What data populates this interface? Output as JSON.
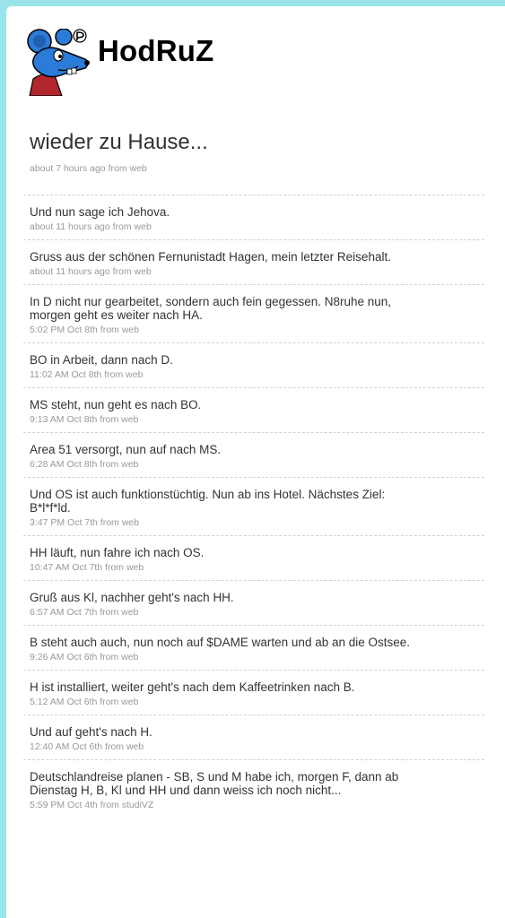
{
  "profile": {
    "username": "HodRuZ"
  },
  "latest": {
    "text": "wieder zu Hause...",
    "meta": "about 7 hours ago from web"
  },
  "timeline": [
    {
      "text": "Und nun sage ich Jehova.",
      "meta": "about 11 hours ago from web"
    },
    {
      "text": "Gruss aus der schönen Fernunistadt Hagen, mein letzter Reisehalt.",
      "meta": "about 11 hours ago from web"
    },
    {
      "text": "In D nicht nur gearbeitet, sondern auch fein gegessen. N8ruhe nun, morgen geht es weiter nach HA.",
      "meta": "5:02 PM Oct 8th from web"
    },
    {
      "text": "BO in Arbeit, dann nach D.",
      "meta": "11:02 AM Oct 8th from web"
    },
    {
      "text": "MS steht, nun geht es nach BO.",
      "meta": "9:13 AM Oct 8th from web"
    },
    {
      "text": "Area 51 versorgt, nun auf nach MS.",
      "meta": "6:28 AM Oct 8th from web"
    },
    {
      "text": "Und OS ist auch funktionstüchtig. Nun ab ins Hotel. Nächstes Ziel: B*l*f*ld.",
      "meta": "3:47 PM Oct 7th from web"
    },
    {
      "text": "HH läuft, nun fahre ich nach OS.",
      "meta": "10:47 AM Oct 7th from web"
    },
    {
      "text": "Gruß aus Kl, nachher geht's nach HH.",
      "meta": "6:57 AM Oct 7th from web"
    },
    {
      "text": "B steht auch auch, nun noch auf $DAME warten und ab an die Ostsee.",
      "meta": "9:26 AM Oct 6th from web"
    },
    {
      "text": "H ist installiert, weiter geht's nach dem Kaffeetrinken nach B.",
      "meta": "5:12 AM Oct 6th from web"
    },
    {
      "text": "Und auf geht's nach H.",
      "meta": "12:40 AM Oct 6th from web"
    },
    {
      "text": "Deutschlandreise planen - SB, S und M habe ich, morgen F, dann ab Dienstag H, B, Kl und HH und dann weiss ich noch nicht...",
      "meta": "5:59 PM Oct 4th from studiVZ"
    }
  ]
}
